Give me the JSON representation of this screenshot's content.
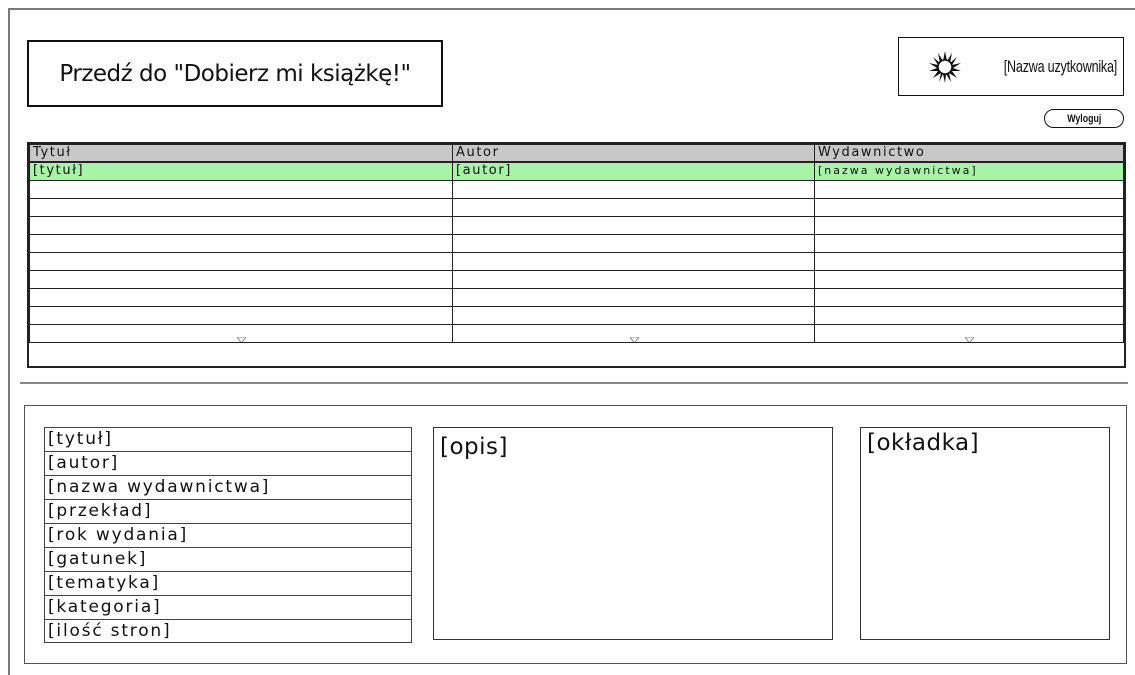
{
  "header": {
    "goto_button": "Przedź do \"Dobierz mi książkę!\"",
    "user_name": "[Nazwa uzytkownika]",
    "logout": "Wyloguj"
  },
  "book_table": {
    "columns": [
      "Tytuł",
      "Autor",
      "Wydawnictwo"
    ],
    "rows": [
      [
        "[tytuł]",
        "[autor]",
        "[nazwa wydawnictwa]"
      ],
      [
        "",
        "",
        ""
      ],
      [
        "",
        "",
        ""
      ],
      [
        "",
        "",
        ""
      ],
      [
        "",
        "",
        ""
      ],
      [
        "",
        "",
        ""
      ],
      [
        "",
        "",
        ""
      ],
      [
        "",
        "",
        ""
      ],
      [
        "",
        "",
        ""
      ],
      [
        "",
        "",
        ""
      ]
    ],
    "selected_row": 0
  },
  "details": {
    "fields": [
      "[tytuł]",
      "[autor]",
      "[nazwa wydawnictwa]",
      "[przekład]",
      "[rok wydania]",
      "[gatunek]",
      "[tematyka]",
      "[kategoria]",
      "[ilość stron]"
    ],
    "description": "[opis]",
    "cover": "[okładka]"
  },
  "colors": {
    "selected_row": "#a5f5a4",
    "header_row": "#c8c8c8"
  },
  "icons": {
    "user": "sun-avatar-icon",
    "scroll": "chevron-down-icon"
  }
}
